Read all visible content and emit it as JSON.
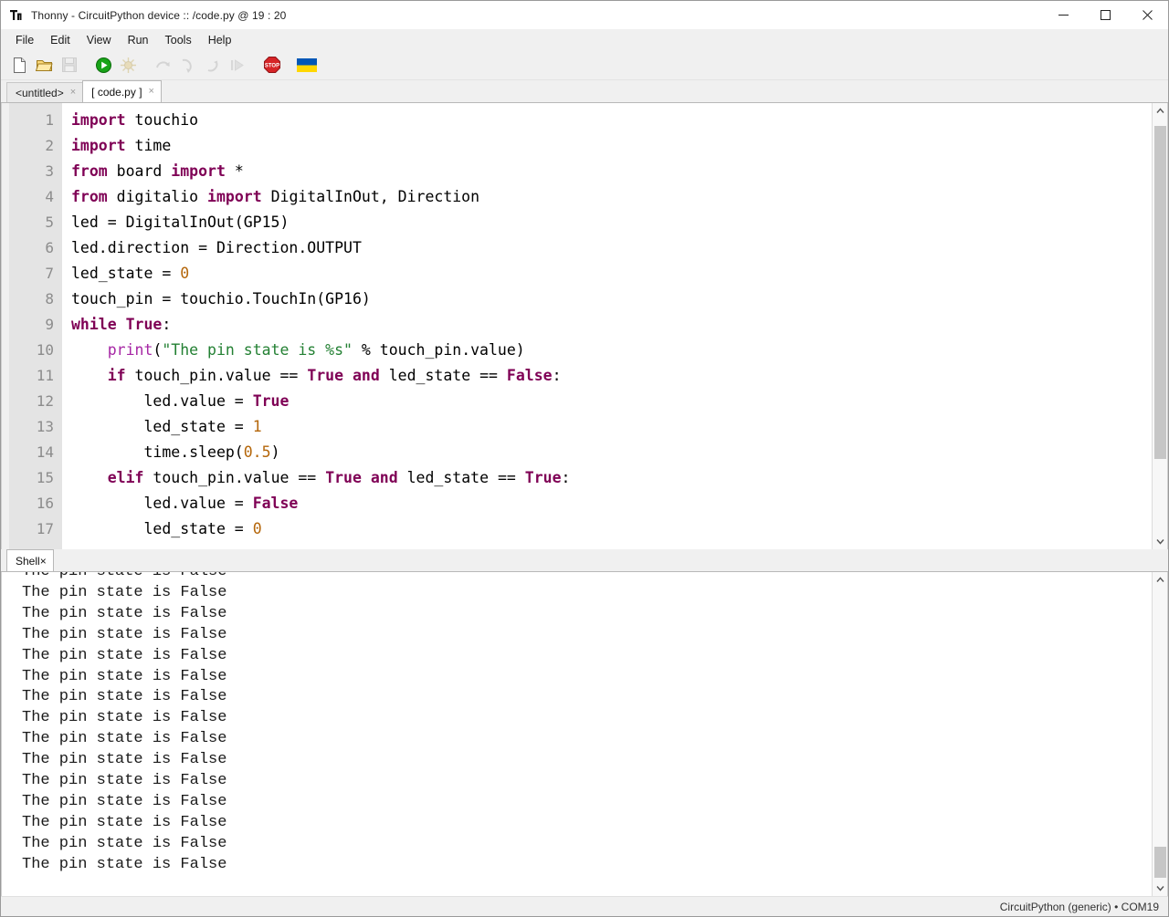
{
  "window": {
    "app_name": "Thonny",
    "title": "Thonny  -  CircuitPython device :: /code.py  @  19 : 20",
    "icon": "thonny-logo-icon",
    "controls": {
      "minimize": "minimize-icon",
      "maximize": "maximize-icon",
      "close": "close-icon"
    }
  },
  "menubar": {
    "items": [
      {
        "label": "File"
      },
      {
        "label": "Edit"
      },
      {
        "label": "View"
      },
      {
        "label": "Run"
      },
      {
        "label": "Tools"
      },
      {
        "label": "Help"
      }
    ]
  },
  "toolbar": {
    "buttons": [
      {
        "name": "new-file-icon",
        "enabled": true
      },
      {
        "name": "open-file-icon",
        "enabled": true
      },
      {
        "name": "save-file-icon",
        "enabled": false
      },
      {
        "name": "run-icon",
        "enabled": true
      },
      {
        "name": "debug-icon",
        "enabled": false
      },
      {
        "name": "step-over-icon",
        "enabled": false
      },
      {
        "name": "step-into-icon",
        "enabled": false
      },
      {
        "name": "step-out-icon",
        "enabled": false
      },
      {
        "name": "resume-icon",
        "enabled": false
      },
      {
        "name": "stop-icon",
        "enabled": true
      },
      {
        "name": "ukraine-flag-icon",
        "enabled": true
      }
    ]
  },
  "editor": {
    "tabs": [
      {
        "label": "<untitled>",
        "active": false,
        "close": "×"
      },
      {
        "label": "[ code.py ]",
        "active": true,
        "close": "×"
      }
    ],
    "line_numbers": [
      "1",
      "2",
      "3",
      "4",
      "5",
      "6",
      "7",
      "8",
      "9",
      "10",
      "11",
      "12",
      "13",
      "14",
      "15",
      "16",
      "17"
    ],
    "lines": [
      {
        "n": 1,
        "tokens": [
          {
            "t": "import",
            "c": "kw"
          },
          {
            "t": " touchio",
            "c": ""
          }
        ]
      },
      {
        "n": 2,
        "tokens": [
          {
            "t": "import",
            "c": "kw"
          },
          {
            "t": " time",
            "c": ""
          }
        ]
      },
      {
        "n": 3,
        "tokens": [
          {
            "t": "from",
            "c": "kw"
          },
          {
            "t": " board ",
            "c": ""
          },
          {
            "t": "import",
            "c": "kw"
          },
          {
            "t": " *",
            "c": ""
          }
        ]
      },
      {
        "n": 4,
        "tokens": [
          {
            "t": "from",
            "c": "kw"
          },
          {
            "t": " digitalio ",
            "c": ""
          },
          {
            "t": "import",
            "c": "kw"
          },
          {
            "t": " DigitalInOut, Direction",
            "c": ""
          }
        ]
      },
      {
        "n": 5,
        "tokens": [
          {
            "t": "led = DigitalInOut(GP15)",
            "c": ""
          }
        ]
      },
      {
        "n": 6,
        "tokens": [
          {
            "t": "led.direction = Direction.OUTPUT",
            "c": ""
          }
        ]
      },
      {
        "n": 7,
        "tokens": [
          {
            "t": "led_state = ",
            "c": ""
          },
          {
            "t": "0",
            "c": "num"
          }
        ]
      },
      {
        "n": 8,
        "tokens": [
          {
            "t": "touch_pin = touchio.TouchIn(GP16)",
            "c": ""
          }
        ]
      },
      {
        "n": 9,
        "tokens": [
          {
            "t": "while",
            "c": "kw"
          },
          {
            "t": " ",
            "c": ""
          },
          {
            "t": "True",
            "c": "kw"
          },
          {
            "t": ":",
            "c": ""
          }
        ]
      },
      {
        "n": 10,
        "tokens": [
          {
            "t": "    ",
            "c": ""
          },
          {
            "t": "print",
            "c": "bin"
          },
          {
            "t": "(",
            "c": ""
          },
          {
            "t": "\"The pin state is %s\"",
            "c": "str"
          },
          {
            "t": " % touch_pin.value)",
            "c": ""
          }
        ]
      },
      {
        "n": 11,
        "tokens": [
          {
            "t": "    ",
            "c": ""
          },
          {
            "t": "if",
            "c": "kw"
          },
          {
            "t": " touch_pin.value == ",
            "c": ""
          },
          {
            "t": "True",
            "c": "kw"
          },
          {
            "t": " ",
            "c": ""
          },
          {
            "t": "and",
            "c": "kw"
          },
          {
            "t": " led_state == ",
            "c": ""
          },
          {
            "t": "False",
            "c": "kw"
          },
          {
            "t": ":",
            "c": ""
          }
        ]
      },
      {
        "n": 12,
        "tokens": [
          {
            "t": "        led.value = ",
            "c": ""
          },
          {
            "t": "True",
            "c": "kw"
          }
        ]
      },
      {
        "n": 13,
        "tokens": [
          {
            "t": "        led_state = ",
            "c": ""
          },
          {
            "t": "1",
            "c": "num"
          }
        ]
      },
      {
        "n": 14,
        "tokens": [
          {
            "t": "        time.sleep(",
            "c": ""
          },
          {
            "t": "0.5",
            "c": "num"
          },
          {
            "t": ")",
            "c": ""
          }
        ]
      },
      {
        "n": 15,
        "tokens": [
          {
            "t": "    ",
            "c": ""
          },
          {
            "t": "elif",
            "c": "kw"
          },
          {
            "t": " touch_pin.value == ",
            "c": ""
          },
          {
            "t": "True",
            "c": "kw"
          },
          {
            "t": " ",
            "c": ""
          },
          {
            "t": "and",
            "c": "kw"
          },
          {
            "t": " led_state == ",
            "c": ""
          },
          {
            "t": "True",
            "c": "kw"
          },
          {
            "t": ":",
            "c": ""
          }
        ]
      },
      {
        "n": 16,
        "tokens": [
          {
            "t": "        led.value = ",
            "c": ""
          },
          {
            "t": "False",
            "c": "kw"
          }
        ]
      },
      {
        "n": 17,
        "tokens": [
          {
            "t": "        led_state = ",
            "c": ""
          },
          {
            "t": "0",
            "c": "num"
          }
        ]
      }
    ],
    "scrollbar": {
      "up": "chevron-up-icon",
      "down": "chevron-down-icon"
    }
  },
  "shell": {
    "tab_label": "Shell",
    "tab_close": "×",
    "partial_top_line": "The pin state is False",
    "lines": [
      "The pin state is False",
      "The pin state is False",
      "The pin state is False",
      "The pin state is False",
      "The pin state is False",
      "The pin state is False",
      "The pin state is False",
      "The pin state is False",
      "The pin state is False",
      "The pin state is False",
      "The pin state is False",
      "The pin state is False",
      "The pin state is False",
      "The pin state is False"
    ],
    "scrollbar": {
      "up": "chevron-up-icon",
      "down": "chevron-down-icon"
    }
  },
  "statusbar": {
    "text": "CircuitPython (generic)  •  COM19"
  },
  "colors": {
    "keyword": "#7f0055",
    "builtin": "#a626a4",
    "string": "#238033",
    "number": "#b4660a",
    "gutter_bg": "#e4e4e4",
    "chrome_bg": "#f0f0f0"
  }
}
